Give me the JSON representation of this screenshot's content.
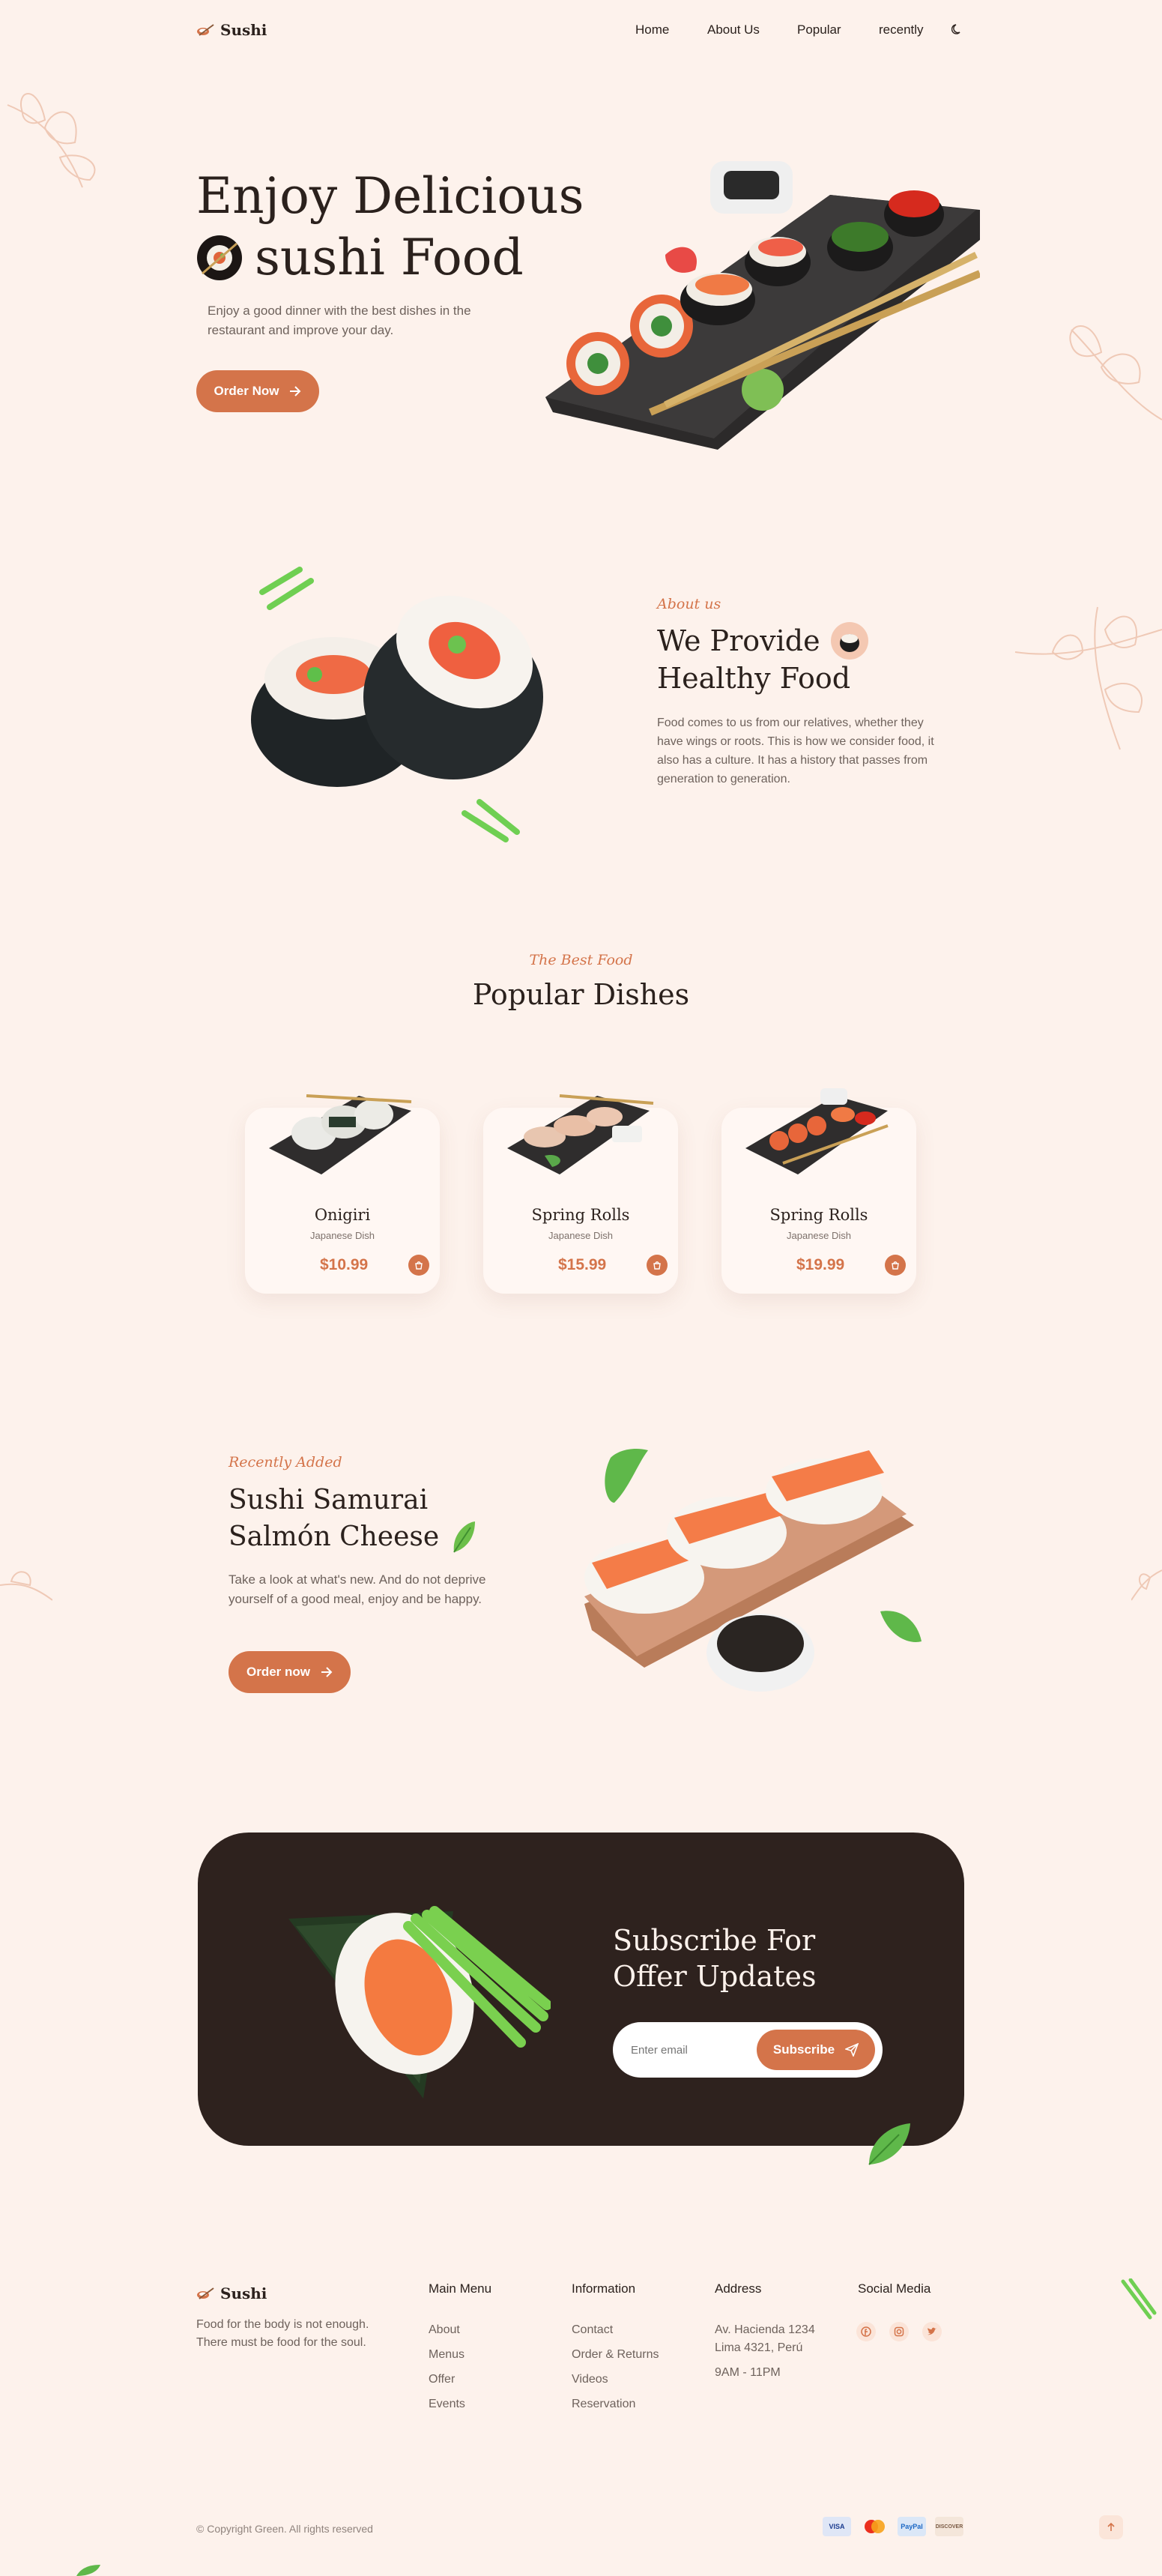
{
  "nav": {
    "logo": "Sushi",
    "links": [
      "Home",
      "About Us",
      "Popular",
      "recently"
    ]
  },
  "hero": {
    "title_line1": "Enjoy Delicious",
    "title_line2": "sushi Food",
    "description": "Enjoy a good dinner with the best dishes in the restaurant and improve your day.",
    "button": "Order Now"
  },
  "about": {
    "eyebrow": "About us",
    "title_line1": "We Provide",
    "title_line2": "Healthy Food",
    "description": "Food comes to us from our relatives, whether they have wings or roots. This is how we consider food, it also has a culture. It has a history that passes from generation to generation."
  },
  "popular": {
    "eyebrow": "The Best Food",
    "title": "Popular Dishes",
    "dishes": [
      {
        "name": "Onigiri",
        "category": "Japanese Dish",
        "price": "$10.99"
      },
      {
        "name": "Spring Rolls",
        "category": "Japanese Dish",
        "price": "$15.99"
      },
      {
        "name": "Spring Rolls",
        "category": "Japanese Dish",
        "price": "$19.99"
      }
    ]
  },
  "recent": {
    "eyebrow": "Recently Added",
    "title_line1": "Sushi Samurai",
    "title_line2": "Salmón Cheese",
    "description": "Take a look at what's new. And do not deprive yourself of a good meal, enjoy and be happy.",
    "button": "Order now"
  },
  "subscribe": {
    "title_line1": "Subscribe For",
    "title_line2": "Offer Updates",
    "placeholder": "Enter email",
    "button": "Subscribe"
  },
  "footer": {
    "logo": "Sushi",
    "tagline": "Food for the body is not enough. There must be food for the soul.",
    "main_menu": {
      "title": "Main Menu",
      "items": [
        "About",
        "Menus",
        "Offer",
        "Events"
      ]
    },
    "information": {
      "title": "Information",
      "items": [
        "Contact",
        "Order & Returns",
        "Videos",
        "Reservation"
      ]
    },
    "address": {
      "title": "Address",
      "line1": "Av. Hacienda 1234",
      "line2": "Lima 4321, Perú",
      "hours": "9AM - 11PM"
    },
    "social": {
      "title": "Social Media",
      "icons": [
        "facebook-icon",
        "instagram-icon",
        "twitter-icon"
      ]
    },
    "copyright": "© Copyright Green. All rights reserved",
    "payments": [
      "VISA",
      "mastercard",
      "PayPal",
      "DISCOVER"
    ]
  },
  "colors": {
    "accent": "#d4744a",
    "background": "#fdf2ec",
    "dark": "#2e221e"
  }
}
